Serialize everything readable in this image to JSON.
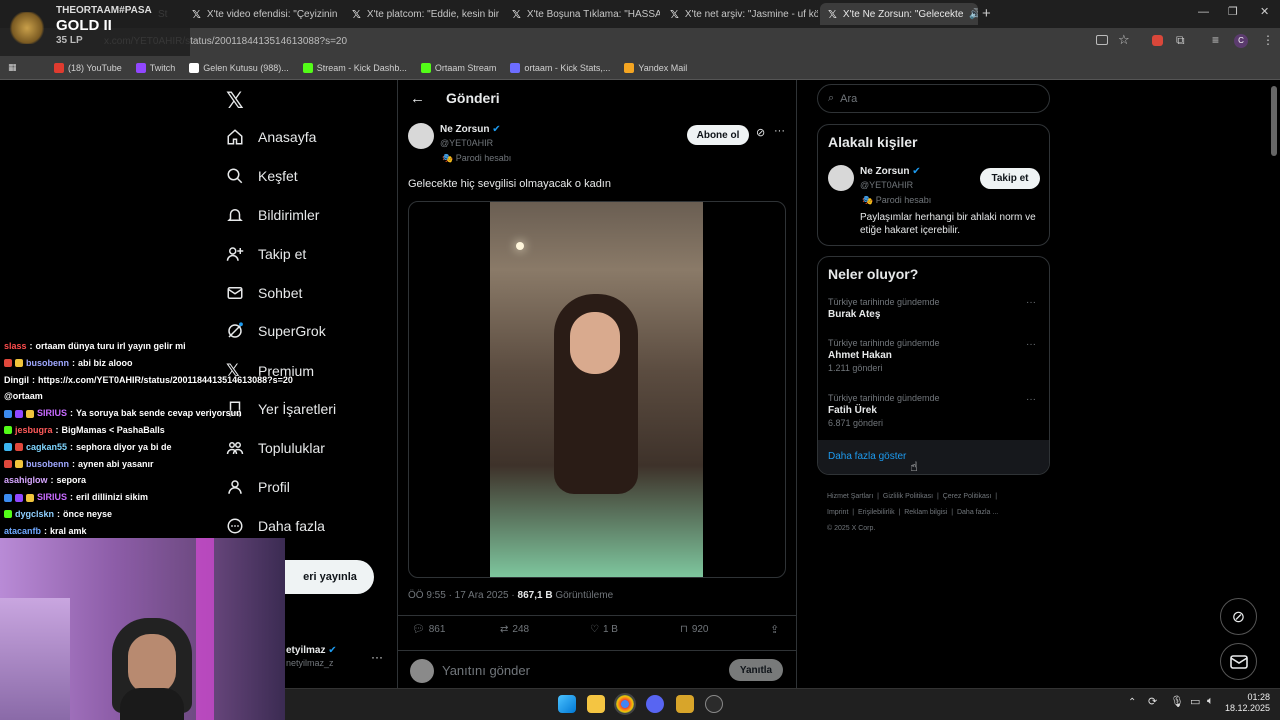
{
  "overlay": {
    "player_name": "THEORTAAM#PASA",
    "rank": "GOLD II",
    "lp": "35 LP",
    "chat": [
      {
        "user": "slass",
        "color": "#ff4d4d",
        "msg": "ortaam dünya turu irl yayın gelir mi"
      },
      {
        "user": "busobenn",
        "color": "#9fa8ff",
        "msg": "abi biz alooo"
      },
      {
        "user": "Dingil",
        "color": "#ffffff",
        "msg": "https://x.com/YET0AHIR/status/2001184413514613088?s=20"
      },
      {
        "user": "",
        "color": "#ffffff",
        "msg": "@ortaam"
      },
      {
        "user": "SIRIUS",
        "color": "#c86bff",
        "msg": "Ya soruya bak sende cevap veriyorsun"
      },
      {
        "user": "jesbugra",
        "color": "#ff5a5a",
        "msg": "BigMamas < PashaBalls"
      },
      {
        "user": "cagkan55",
        "color": "#7fd6ff",
        "msg": "sephora diyor ya bi de"
      },
      {
        "user": "busobenn",
        "color": "#9fa8ff",
        "msg": "aynen abi yasanır"
      },
      {
        "user": "asahiglow",
        "color": "#d6a6ff",
        "msg": "sepora"
      },
      {
        "user": "SIRIUS",
        "color": "#c86bff",
        "msg": "eril dillinizi sikim"
      },
      {
        "user": "dygclskn",
        "color": "#8fd0ff",
        "msg": "önce neyse"
      },
      {
        "user": "atacanfb",
        "color": "#6fa8ff",
        "msg": "kral amk"
      }
    ]
  },
  "browser": {
    "tabs": [
      {
        "label": "St",
        "active": false
      },
      {
        "label": "X'te video efendisi: \"Çeyizinin d",
        "active": false
      },
      {
        "label": "X'te platcom: \"Eddie, kesin bir",
        "active": false
      },
      {
        "label": "X'te Boşuna Tıklama: \"HASSAS",
        "active": false
      },
      {
        "label": "X'te net arşiv: \"Jasmine - uf köt",
        "active": false
      },
      {
        "label": "X'te Ne Zorsun: \"Gelecekte",
        "active": true
      }
    ],
    "url": "x.com/YET0AHIR/status/2001184413514613088?s=20",
    "bookmarks": [
      "(18) YouTube",
      "Twitch",
      "Gelen Kutusu (988)...",
      "Stream - Kick Dashb...",
      "Ortaam Stream",
      "ortaam - Kick Stats,...",
      "Yandex Mail"
    ]
  },
  "nav": {
    "items": [
      "Anasayfa",
      "Keşfet",
      "Bildirimler",
      "Takip et",
      "Sohbet",
      "SuperGrok",
      "Premium",
      "Yer İşaretleri",
      "Topluluklar",
      "Profil",
      "Daha fazla"
    ],
    "post_button": "eri yayınla",
    "account_name": "etyilmaz",
    "account_handle": "netyilmaz_z"
  },
  "post": {
    "header": "Gönderi",
    "author": "Ne Zorsun",
    "handle": "@YET0AHIR",
    "parody_label": "Parodi hesabı",
    "subscribe_label": "Abone ol",
    "text": "Gelecekte hiç sevgilisi olmayacak o kadın",
    "time": "ÖÖ 9:55 · 17 Ara 2025 ·",
    "views": "867,1 B",
    "views_label": "Görüntüleme",
    "replies": "861",
    "reposts": "248",
    "likes": "1 B",
    "bookmarks": "920",
    "reply_placeholder": "Yanıtını gönder",
    "reply_button": "Yanıtla"
  },
  "sidebar": {
    "search_placeholder": "Ara",
    "related_title": "Alakalı kişiler",
    "related": {
      "name": "Ne Zorsun",
      "handle": "@YET0AHIR",
      "parody": "Parodi hesabı",
      "bio": "Paylaşımlar herhangi bir ahlaki norm ve etiğe hakaret içerebilir.",
      "follow_label": "Takip et"
    },
    "trends_title": "Neler oluyor?",
    "trends": [
      {
        "meta": "Türkiye tarihinde gündemde",
        "name": "Burak Ateş",
        "count": ""
      },
      {
        "meta": "Türkiye tarihinde gündemde",
        "name": "Ahmet Hakan",
        "count": "1.211 gönderi"
      },
      {
        "meta": "Türkiye tarihinde gündemde",
        "name": "Fatih Ürek",
        "count": "6.871 gönderi"
      }
    ],
    "show_more": "Daha fazla göster",
    "footer": [
      "Hizmet Şartları",
      "Gizlilik Politikası",
      "Çerez Politikası",
      "Imprint",
      "Erişilebilirlik",
      "Reklam bilgisi",
      "Daha fazla ...",
      "© 2025 X Corp."
    ]
  },
  "taskbar": {
    "time": "01:28",
    "date": "18.12.2025"
  },
  "colors": {
    "accent": "#1d9bf0",
    "background": "#000000",
    "border": "#2f3336"
  }
}
